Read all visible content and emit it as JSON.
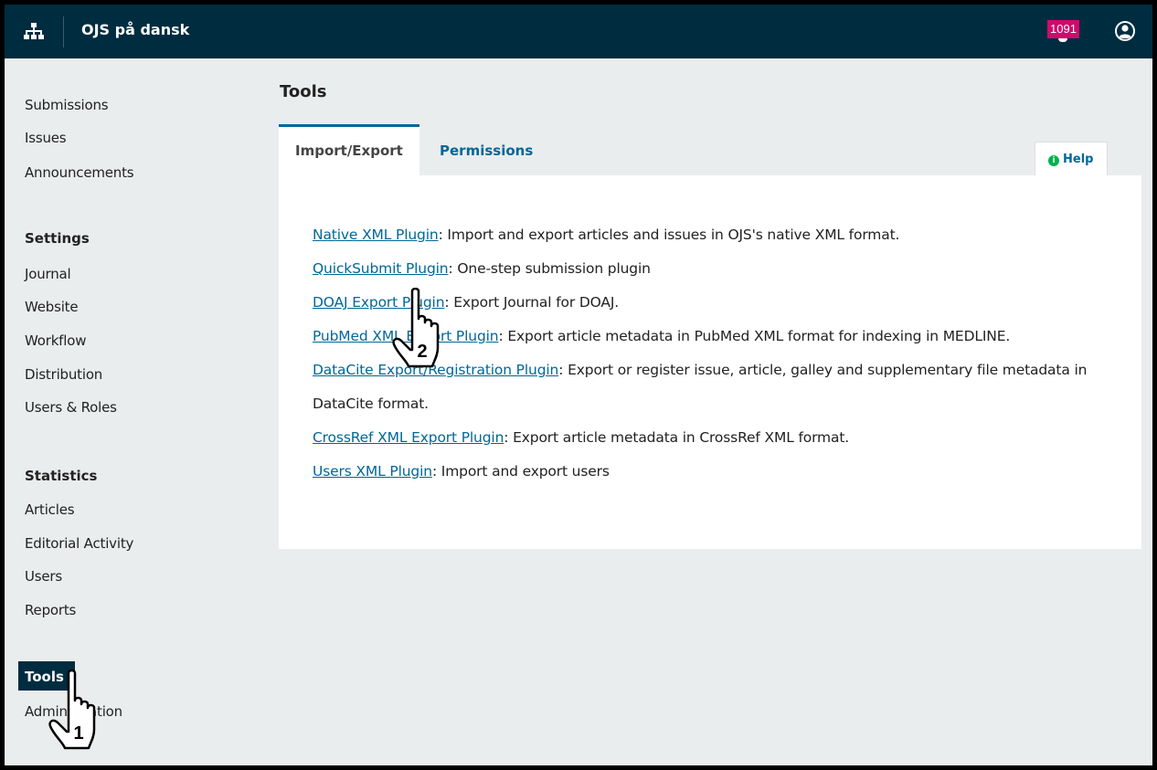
{
  "header": {
    "site_title": "OJS på dansk",
    "notification_count": "1091",
    "site_icon": "sitemap-icon",
    "user_icon": "user-circle-icon"
  },
  "sidebar": {
    "items": [
      {
        "label": "Submissions"
      },
      {
        "label": "Issues"
      },
      {
        "label": "Announcements"
      }
    ],
    "settings": {
      "heading": "Settings",
      "items": [
        {
          "label": "Journal"
        },
        {
          "label": "Website"
        },
        {
          "label": "Workflow"
        },
        {
          "label": "Distribution"
        },
        {
          "label": "Users & Roles"
        }
      ]
    },
    "statistics": {
      "heading": "Statistics",
      "items": [
        {
          "label": "Articles"
        },
        {
          "label": "Editorial Activity"
        },
        {
          "label": "Users"
        },
        {
          "label": "Reports"
        }
      ]
    },
    "tools": "Tools",
    "administration": "Administration"
  },
  "main": {
    "title": "Tools",
    "tabs": [
      {
        "label": "Import/Export",
        "active": true
      },
      {
        "label": "Permissions",
        "active": false
      }
    ],
    "help": "Help",
    "plugins": [
      {
        "link": "Native XML Plugin",
        "desc": ": Import and export articles and issues in OJS's native XML format."
      },
      {
        "link": "QuickSubmit Plugin",
        "desc": ": One-step submission plugin"
      },
      {
        "link": "DOAJ Export Plugin",
        "desc": ": Export Journal for DOAJ."
      },
      {
        "link": "PubMed XML Export Plugin",
        "desc": ": Export article metadata in PubMed XML format for indexing in MEDLINE."
      },
      {
        "link": "DataCite Export/Registration Plugin",
        "desc": ": Export or register issue, article, galley and supplementary file metadata in DataCite format."
      },
      {
        "link": "CrossRef XML Export Plugin",
        "desc": ": Export article metadata in CrossRef XML format."
      },
      {
        "link": "Users XML Plugin",
        "desc": ": Import and export users"
      }
    ]
  },
  "annotations": {
    "step1": "1",
    "step2": "2"
  },
  "colors": {
    "header_bg": "#002c40",
    "link": "#006798",
    "badge": "#d00a6c",
    "page_bg": "#eaedee"
  }
}
